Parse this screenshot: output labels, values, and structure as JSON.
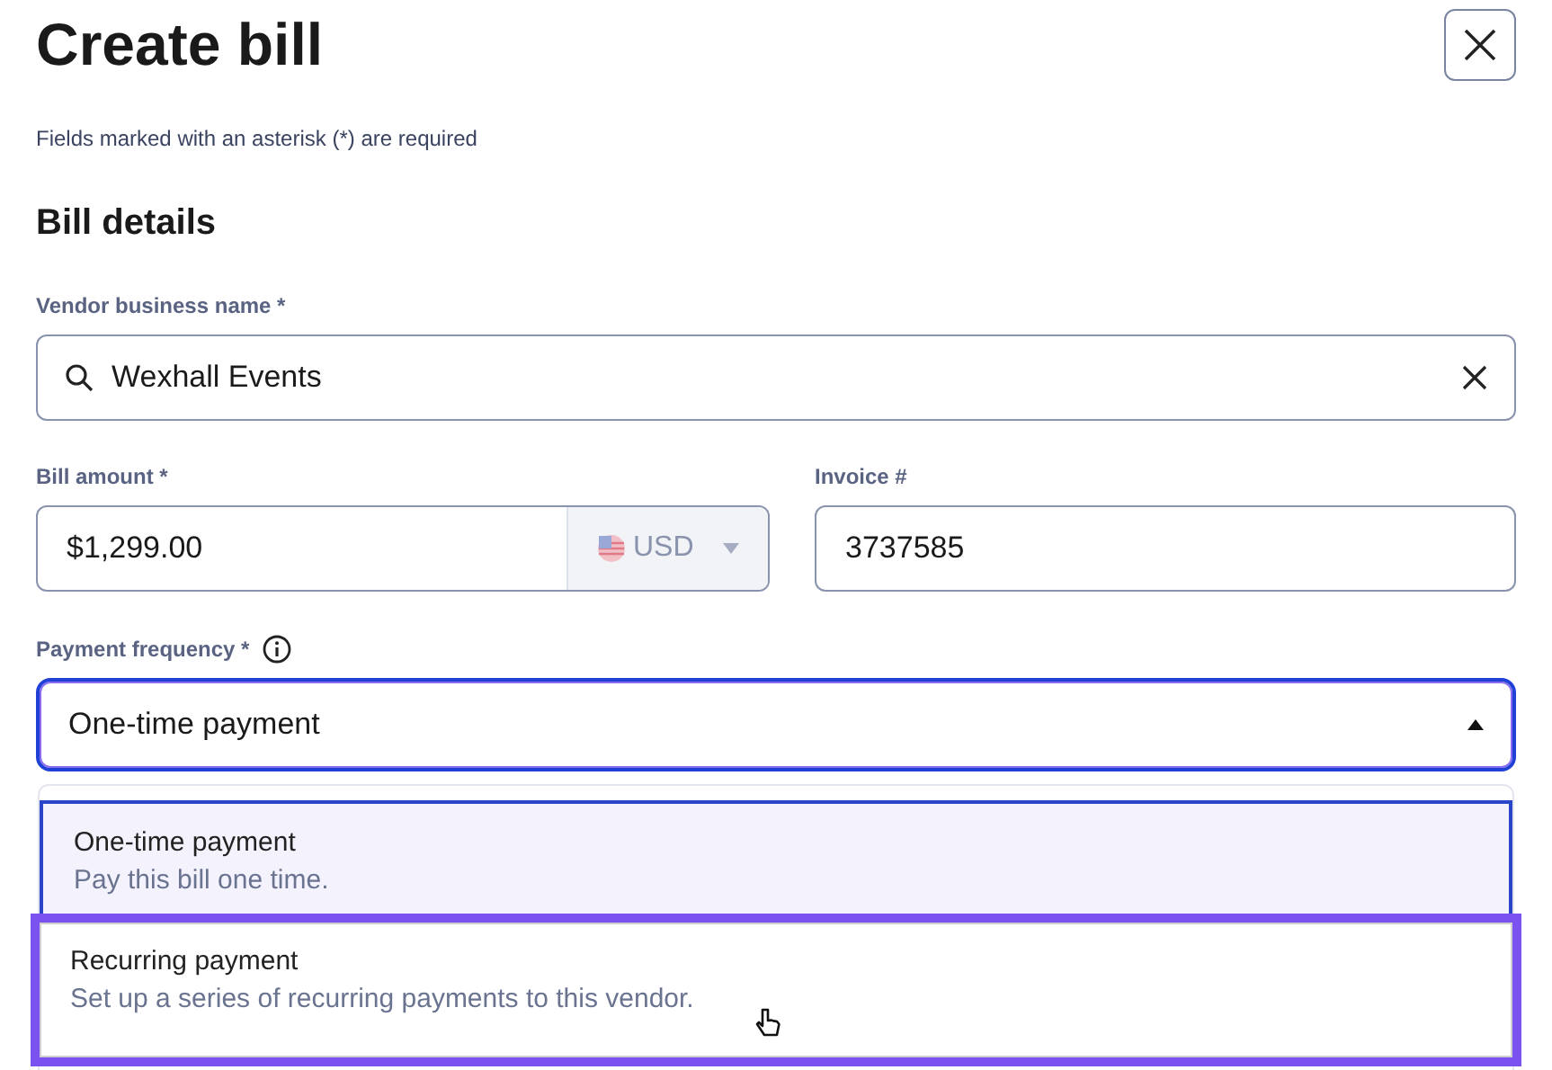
{
  "title": "Create bill",
  "required_note": "Fields marked with an asterisk (*) are required",
  "section_title": "Bill details",
  "vendor": {
    "label": "Vendor business name *",
    "value": "Wexhall Events"
  },
  "amount": {
    "label": "Bill amount *",
    "value": "$1,299.00",
    "currency": "USD"
  },
  "invoice": {
    "label": "Invoice #",
    "value": "3737585"
  },
  "frequency": {
    "label": "Payment frequency *",
    "value": "One-time payment",
    "expanded": true,
    "options": [
      {
        "title": "One-time payment",
        "description": "Pay this bill one time.",
        "selected": true,
        "hovered": false
      },
      {
        "title": "Recurring payment",
        "description": "Set up a series of recurring payments to this vendor.",
        "selected": false,
        "hovered": true
      }
    ]
  }
}
